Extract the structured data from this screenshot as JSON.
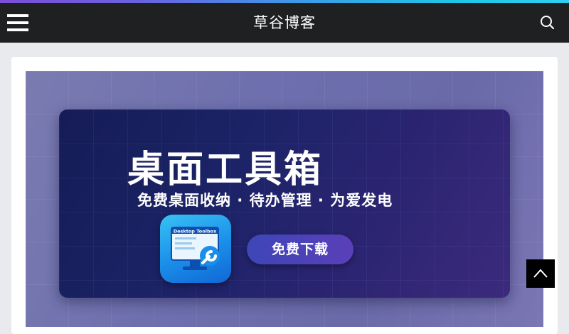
{
  "header": {
    "site_title": "草谷博客",
    "menu_icon": "hamburger-menu-icon",
    "search_icon": "search-icon"
  },
  "banner": {
    "title": "桌面工具箱",
    "subtitle": "免费桌面收纳 · 待办管理 · 为爱发电",
    "app_icon_label": "Desktop Toolbox",
    "download_label": "免费下载"
  },
  "back_to_top_icon": "chevron-up-icon",
  "colors": {
    "header_bg": "#1e2022",
    "page_bg": "#e9eaed",
    "panel_bg": "#1b2366",
    "button_bg": "#4a42b8"
  }
}
